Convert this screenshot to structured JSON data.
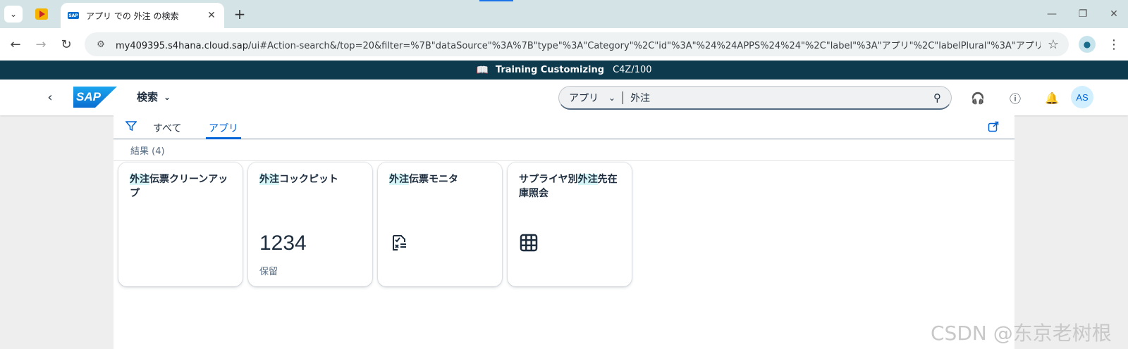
{
  "browser": {
    "active_tab_title": "アプリ での 外注 の検索",
    "new_tab_symbol": "+",
    "url_host": "my409395.s4hana.cloud.sap",
    "url_rest": "/ui#Action-search&/top=20&filter=%7B\"dataSource\"%3A%7B\"type\"%3A\"Category\"%2C\"id\"%3A\"%24%24APPS%24%24\"%2C\"label\"%3A\"アプリ\"%2C\"labelPlural\"%3A\"アプリ\"%7D%2C\"s..."
  },
  "system_banner": {
    "name": "Training Customizing",
    "client": "C4Z/100"
  },
  "shell": {
    "title": "検索",
    "search_scope": "アプリ",
    "search_query": "外注",
    "avatar_initials": "AS"
  },
  "tabs": [
    {
      "label": "すべて"
    },
    {
      "label": "アプリ"
    }
  ],
  "results_label": "結果 (4)",
  "tiles": [
    {
      "title_hl": "外注",
      "title_rest": "伝票クリーンアップ",
      "type": "text"
    },
    {
      "title_hl": "外注",
      "title_rest": "コックピット",
      "kpi_value": "1234",
      "kpi_sub": "保留",
      "type": "kpi"
    },
    {
      "title_hl": "外注",
      "title_rest": "伝票モニタ",
      "type": "icon",
      "icon": "document-approval-icon"
    },
    {
      "title_pre": "サプライヤ別",
      "title_hl": "外注",
      "title_rest": "先在庫照会",
      "type": "icon",
      "icon": "grid-table-icon"
    }
  ],
  "watermark": "CSDN @东京老树根",
  "colors": {
    "shell_banner": "#0e3a4d",
    "accent": "#0064d9",
    "highlight": "#d6f5f7"
  }
}
